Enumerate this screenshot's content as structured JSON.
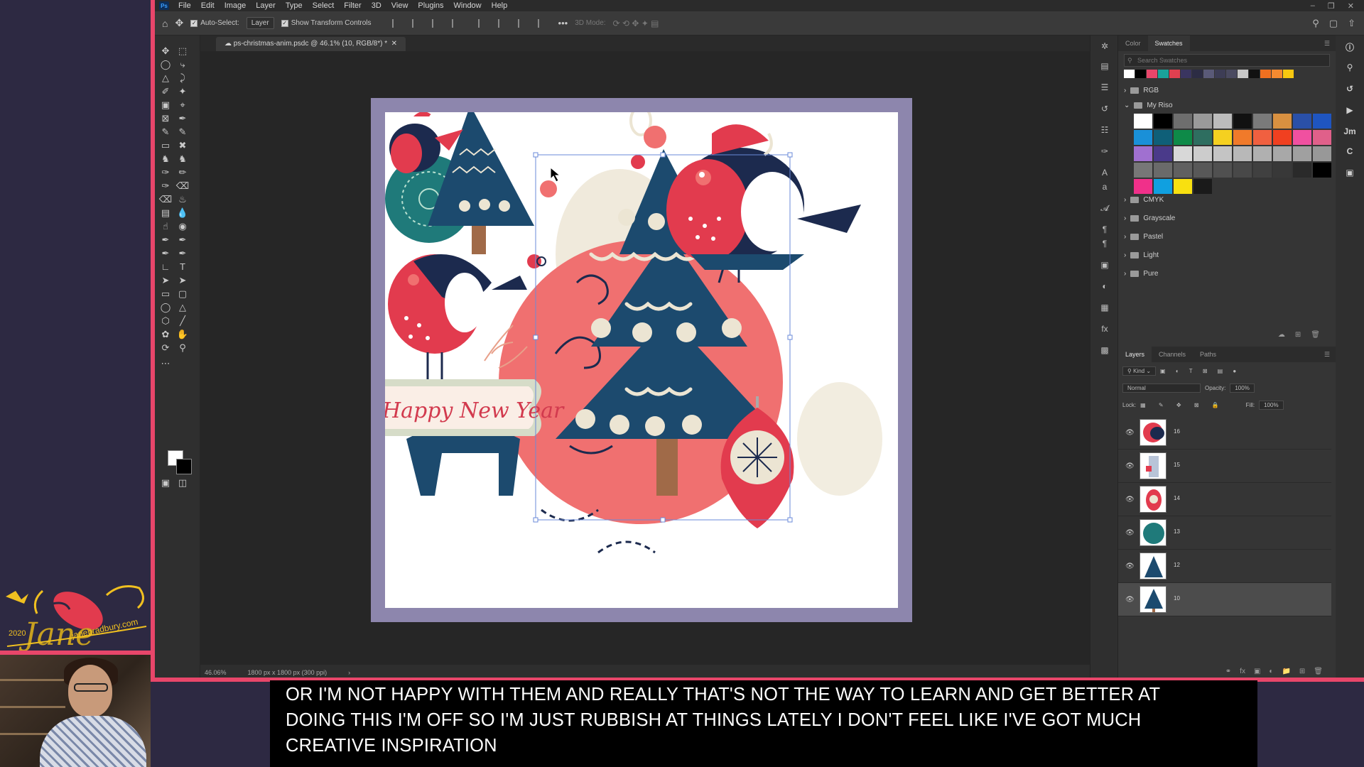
{
  "branding": {
    "logo_name": "Jane",
    "logo_url": "janebradbury.com",
    "logo_year": "2020"
  },
  "app": {
    "logo": "Ps",
    "menu": [
      "File",
      "Edit",
      "Image",
      "Layer",
      "Type",
      "Select",
      "Filter",
      "3D",
      "View",
      "Plugins",
      "Window",
      "Help"
    ]
  },
  "options_bar": {
    "auto_select_label": "Auto-Select:",
    "auto_select_value": "Layer",
    "transform_label": "Show Transform Controls",
    "mode_3d": "3D Mode:"
  },
  "document": {
    "tab_title": "ps-christmas-anim.psdc @ 46.1% (10, RGB/8*) *",
    "card_text": "Happy New Year"
  },
  "status": {
    "zoom": "46.06%",
    "size": "1800 px x 1800 px (300 ppi)"
  },
  "swatches_panel": {
    "tabs": [
      "Color",
      "Swatches"
    ],
    "active_tab": "Swatches",
    "search_placeholder": "Search Swatches",
    "recent": [
      "#ffffff",
      "#000000",
      "#e8466a",
      "#1aa39a",
      "#e04050",
      "#3a3560",
      "#2c2c44",
      "#5a5a78",
      "#3d3d55",
      "#4a4a60",
      "#c8c8c8",
      "#111111",
      "#f07020",
      "#f58a30",
      "#f8c810"
    ],
    "groups": [
      {
        "name": "RGB",
        "open": false
      },
      {
        "name": "My Riso",
        "open": true
      },
      {
        "name": "CMYK",
        "open": false
      },
      {
        "name": "Grayscale",
        "open": false
      },
      {
        "name": "Pastel",
        "open": false
      },
      {
        "name": "Light",
        "open": false
      },
      {
        "name": "Pure",
        "open": false
      }
    ],
    "riso_colors": [
      "#ffffff",
      "#000000",
      "#6e6e6e",
      "#9a9a9a",
      "#bcbcbc",
      "#111111",
      "#7a7a7a",
      "#d89040",
      "#2a50a8",
      "#1f55c0",
      "#1a90d8",
      "#0f5f78",
      "#0e8a48",
      "#2e6e60",
      "#f5d020",
      "#f07a2a",
      "#f06040",
      "#f04020",
      "#f050a0",
      "#e0608a",
      "#a070d0",
      "#4a3a8a",
      "#d8d8d8",
      "#cccccc",
      "#c4c4c4",
      "#b8b8b8",
      "#b0b0b0",
      "#a8a8a8",
      "#a0a0a0",
      "#989898",
      "#777777",
      "#6a6a6a",
      "#606060",
      "#585858",
      "#505050",
      "#484848",
      "#404040",
      "#383838",
      "#2a2a2a",
      "#000000",
      "#f0308a",
      "#10a0e0",
      "#f8e010",
      "#1a1a1a"
    ]
  },
  "layers_panel": {
    "tabs": [
      "Layers",
      "Channels",
      "Paths"
    ],
    "active_tab": "Layers",
    "filter_kind": "Kind",
    "blend_mode": "Normal",
    "opacity_label": "Opacity:",
    "opacity_value": "100%",
    "lock_label": "Lock:",
    "fill_label": "Fill:",
    "fill_value": "100%",
    "layers": [
      {
        "name": "16",
        "selected": false
      },
      {
        "name": "15",
        "selected": false
      },
      {
        "name": "14",
        "selected": false
      },
      {
        "name": "13",
        "selected": false
      },
      {
        "name": "12",
        "selected": false
      },
      {
        "name": "10",
        "selected": true
      }
    ]
  },
  "caption": {
    "line1": "OR I'M NOT HAPPY WITH THEM AND REALLY THAT'S NOT THE WAY TO LEARN AND GET BETTER AT",
    "line2": "DOING THIS I'M OFF SO I'M JUST RUBBISH AT THINGS LATELY I DON'T FEEL LIKE I'VE GOT MUCH",
    "line3": "CREATIVE INSPIRATION"
  },
  "colors": {
    "accent_pink": "#e8466a",
    "navy": "#1c4a6e",
    "teal": "#1f7a7a",
    "red": "#e23b4e",
    "salmon": "#f07070",
    "artboard_border": "#8d86ad"
  }
}
